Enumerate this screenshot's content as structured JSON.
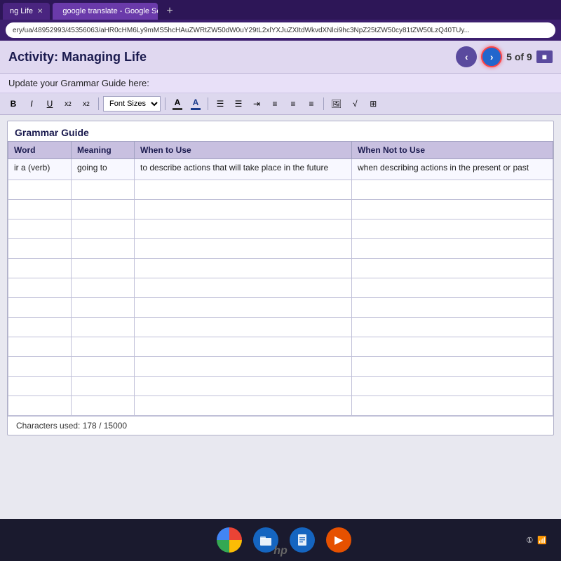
{
  "browser": {
    "tabs": [
      {
        "id": "tab1",
        "label": "ng Life",
        "active": false,
        "icon": "page"
      },
      {
        "id": "tab2",
        "label": "google translate - Google Search",
        "active": true,
        "icon": "google"
      }
    ],
    "address": "ery/ua/48952993/45356063/aHR0cHM6Ly9mMS5hcHAuZWRtZW50dW0uY29tL2xlYXJuZXItdWkvdXNlci9hc3NpZ25tZW50cy81tZW50LzQ40TUy..."
  },
  "activity": {
    "title": "Activity: Managing Life",
    "instructions": "Update your Grammar Guide here:",
    "page_current": "5",
    "page_total": "9",
    "page_label": "5 of 9"
  },
  "toolbar": {
    "bold_label": "B",
    "italic_label": "I",
    "underline_label": "U",
    "superscript_label": "x²",
    "subscript_label": "x₂",
    "font_sizes_label": "Font Sizes",
    "font_color_label": "A",
    "highlight_label": "A",
    "list_label": "≡",
    "numbered_list_label": "≡",
    "indent_label": "⇥",
    "align_left_label": "≡",
    "align_center_label": "≡",
    "align_right_label": "≡",
    "image_label": "🖼",
    "formula_label": "√",
    "table_label": "⊞"
  },
  "grammar_guide": {
    "title": "Grammar Guide",
    "columns": [
      {
        "id": "word",
        "label": "Word"
      },
      {
        "id": "meaning",
        "label": "Meaning"
      },
      {
        "id": "when_to_use",
        "label": "When to Use"
      },
      {
        "id": "when_not_to_use",
        "label": "When Not to Use"
      }
    ],
    "rows": [
      {
        "word": "ir a (verb)",
        "meaning": "going to",
        "when_to_use": "to describe actions that will take place in the future",
        "when_not_to_use": "when describing actions in the present or past"
      }
    ],
    "empty_rows": 12
  },
  "char_count": {
    "label": "Characters used: 178 / 15000"
  },
  "taskbar": {
    "icons": [
      {
        "id": "chrome",
        "type": "chrome"
      },
      {
        "id": "files",
        "type": "files"
      },
      {
        "id": "docs",
        "type": "docs"
      },
      {
        "id": "play",
        "type": "play"
      }
    ],
    "wifi": "WiFi",
    "battery": "①"
  },
  "hp": {
    "logo": "hp"
  }
}
